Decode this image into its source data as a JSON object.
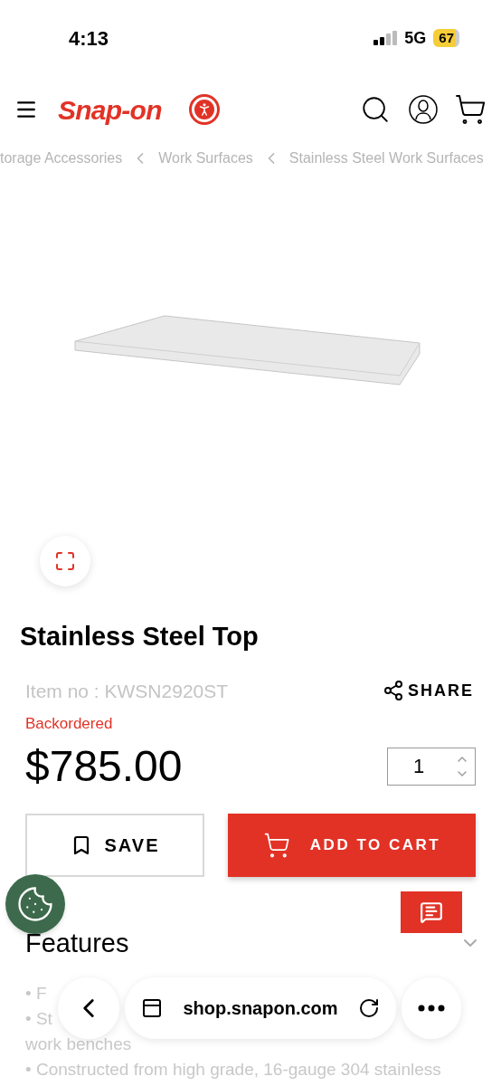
{
  "status_bar": {
    "time": "4:13",
    "network": "5G",
    "battery": "67"
  },
  "header": {
    "logo": "Snap-on"
  },
  "breadcrumbs": [
    "torage Accessories",
    "Work Surfaces",
    "Stainless Steel Work Surfaces"
  ],
  "product": {
    "title": "Stainless Steel Top",
    "item_no": "Item no : KWSN2920ST",
    "share": "SHARE",
    "availability": "Backordered",
    "price": "$785.00",
    "quantity": "1"
  },
  "buttons": {
    "save": "SAVE",
    "add_to_cart": "ADD TO CART"
  },
  "features": {
    "title": "Features",
    "expanded": true,
    "lines": [
      "• F",
      "• St",
      "work benches",
      "• Constructed from high grade, 16-gauge 304 stainless"
    ]
  },
  "browser_bar": {
    "url": "shop.snapon.com"
  }
}
